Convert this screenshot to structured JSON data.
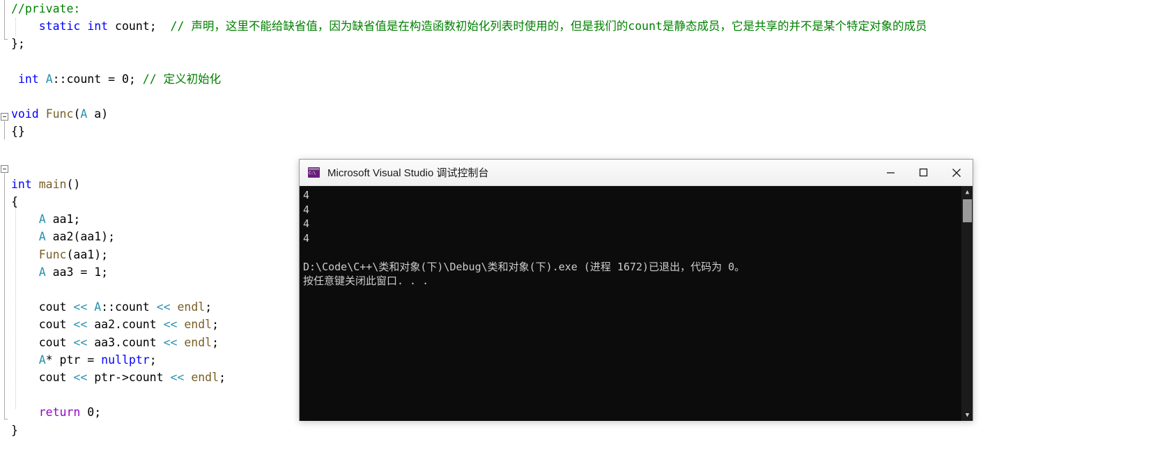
{
  "editor": {
    "lines": [
      {
        "indent": 0,
        "tokens": [
          {
            "cls": "cmt",
            "t": "//private:"
          }
        ]
      },
      {
        "indent": 0,
        "tokens": [
          {
            "cls": "plain",
            "t": "    "
          },
          {
            "cls": "kw",
            "t": "static"
          },
          {
            "cls": "plain",
            "t": " "
          },
          {
            "cls": "kw",
            "t": "int"
          },
          {
            "cls": "plain",
            "t": " count;  "
          },
          {
            "cls": "cmt",
            "t": "// 声明，这里不能给缺省值，因为缺省值是在构造函数初始化列表时使用的，但是我们的count是静态成员，它是共享的并不是某个特定对象的成员"
          }
        ]
      },
      {
        "indent": 0,
        "tokens": [
          {
            "cls": "plain",
            "t": "};"
          }
        ]
      },
      {
        "indent": 0,
        "tokens": [
          {
            "cls": "plain",
            "t": ""
          }
        ]
      },
      {
        "indent": 0,
        "tokens": [
          {
            "cls": "plain",
            "t": " "
          },
          {
            "cls": "kw",
            "t": "int"
          },
          {
            "cls": "plain",
            "t": " "
          },
          {
            "cls": "type",
            "t": "A"
          },
          {
            "cls": "plain",
            "t": "::count = "
          },
          {
            "cls": "plain",
            "t": "0"
          },
          {
            "cls": "plain",
            "t": "; "
          },
          {
            "cls": "cmt",
            "t": "// 定义初始化"
          }
        ]
      },
      {
        "indent": 0,
        "tokens": [
          {
            "cls": "plain",
            "t": ""
          }
        ]
      },
      {
        "indent": 0,
        "tokens": [
          {
            "cls": "kw",
            "t": "void"
          },
          {
            "cls": "plain",
            "t": " "
          },
          {
            "cls": "fn",
            "t": "Func"
          },
          {
            "cls": "plain",
            "t": "("
          },
          {
            "cls": "type",
            "t": "A"
          },
          {
            "cls": "plain",
            "t": " "
          },
          {
            "cls": "id",
            "t": "a"
          },
          {
            "cls": "plain",
            "t": ")"
          }
        ]
      },
      {
        "indent": 0,
        "tokens": [
          {
            "cls": "plain",
            "t": "{}"
          }
        ]
      },
      {
        "indent": 0,
        "tokens": [
          {
            "cls": "plain",
            "t": ""
          }
        ]
      },
      {
        "indent": 0,
        "tokens": [
          {
            "cls": "plain",
            "t": ""
          }
        ]
      },
      {
        "indent": 0,
        "tokens": [
          {
            "cls": "kw",
            "t": "int"
          },
          {
            "cls": "plain",
            "t": " "
          },
          {
            "cls": "fn",
            "t": "main"
          },
          {
            "cls": "plain",
            "t": "()"
          }
        ]
      },
      {
        "indent": 0,
        "tokens": [
          {
            "cls": "plain",
            "t": "{"
          }
        ]
      },
      {
        "indent": 0,
        "tokens": [
          {
            "cls": "plain",
            "t": "    "
          },
          {
            "cls": "type",
            "t": "A"
          },
          {
            "cls": "plain",
            "t": " aa1;"
          }
        ]
      },
      {
        "indent": 0,
        "tokens": [
          {
            "cls": "plain",
            "t": "    "
          },
          {
            "cls": "type",
            "t": "A"
          },
          {
            "cls": "plain",
            "t": " aa2(aa1);"
          }
        ]
      },
      {
        "indent": 0,
        "tokens": [
          {
            "cls": "plain",
            "t": "    "
          },
          {
            "cls": "fn",
            "t": "Func"
          },
          {
            "cls": "plain",
            "t": "(aa1);"
          }
        ]
      },
      {
        "indent": 0,
        "tokens": [
          {
            "cls": "plain",
            "t": "    "
          },
          {
            "cls": "type",
            "t": "A"
          },
          {
            "cls": "plain",
            "t": " aa3 = "
          },
          {
            "cls": "plain",
            "t": "1"
          },
          {
            "cls": "plain",
            "t": ";"
          }
        ]
      },
      {
        "indent": 0,
        "tokens": [
          {
            "cls": "plain",
            "t": ""
          }
        ]
      },
      {
        "indent": 0,
        "tokens": [
          {
            "cls": "plain",
            "t": "    cout "
          },
          {
            "cls": "strm",
            "t": "<<"
          },
          {
            "cls": "plain",
            "t": " "
          },
          {
            "cls": "type",
            "t": "A"
          },
          {
            "cls": "plain",
            "t": "::count "
          },
          {
            "cls": "strm",
            "t": "<<"
          },
          {
            "cls": "plain",
            "t": " "
          },
          {
            "cls": "fn",
            "t": "endl"
          },
          {
            "cls": "plain",
            "t": ";"
          }
        ]
      },
      {
        "indent": 0,
        "tokens": [
          {
            "cls": "plain",
            "t": "    cout "
          },
          {
            "cls": "strm",
            "t": "<<"
          },
          {
            "cls": "plain",
            "t": " aa2.count "
          },
          {
            "cls": "strm",
            "t": "<<"
          },
          {
            "cls": "plain",
            "t": " "
          },
          {
            "cls": "fn",
            "t": "endl"
          },
          {
            "cls": "plain",
            "t": ";"
          }
        ]
      },
      {
        "indent": 0,
        "tokens": [
          {
            "cls": "plain",
            "t": "    cout "
          },
          {
            "cls": "strm",
            "t": "<<"
          },
          {
            "cls": "plain",
            "t": " aa3.count "
          },
          {
            "cls": "strm",
            "t": "<<"
          },
          {
            "cls": "plain",
            "t": " "
          },
          {
            "cls": "fn",
            "t": "endl"
          },
          {
            "cls": "plain",
            "t": ";"
          }
        ]
      },
      {
        "indent": 0,
        "tokens": [
          {
            "cls": "plain",
            "t": "    "
          },
          {
            "cls": "type",
            "t": "A"
          },
          {
            "cls": "plain",
            "t": "* ptr = "
          },
          {
            "cls": "kw",
            "t": "nullptr"
          },
          {
            "cls": "plain",
            "t": ";"
          }
        ]
      },
      {
        "indent": 0,
        "tokens": [
          {
            "cls": "plain",
            "t": "    cout "
          },
          {
            "cls": "strm",
            "t": "<<"
          },
          {
            "cls": "plain",
            "t": " ptr->count "
          },
          {
            "cls": "strm",
            "t": "<<"
          },
          {
            "cls": "plain",
            "t": " "
          },
          {
            "cls": "fn",
            "t": "endl"
          },
          {
            "cls": "plain",
            "t": ";"
          }
        ]
      },
      {
        "indent": 0,
        "tokens": [
          {
            "cls": "plain",
            "t": ""
          }
        ]
      },
      {
        "indent": 0,
        "tokens": [
          {
            "cls": "plain",
            "t": "    "
          },
          {
            "cls": "ctrl",
            "t": "return"
          },
          {
            "cls": "plain",
            "t": " "
          },
          {
            "cls": "plain",
            "t": "0"
          },
          {
            "cls": "plain",
            "t": ";"
          }
        ]
      },
      {
        "indent": 0,
        "tokens": [
          {
            "cls": "plain",
            "t": "}"
          }
        ]
      }
    ]
  },
  "console": {
    "title": "Microsoft Visual Studio 调试控制台",
    "icon": "console-window-icon",
    "minimize_label": "—",
    "maximize_label": "□",
    "close_label": "✕",
    "scroll_up_label": "▲",
    "scroll_down_label": "▼",
    "output": "4\n4\n4\n4\n\nD:\\Code\\C++\\类和对象(下)\\Debug\\类和对象(下).exe (进程 1672)已退出，代码为 0。\n按任意键关闭此窗口. . .",
    "colors": {
      "background": "#0c0c0c",
      "foreground": "#cccccc",
      "titlebar": "#f0f0f0",
      "icon_accent": "#68217a"
    }
  }
}
